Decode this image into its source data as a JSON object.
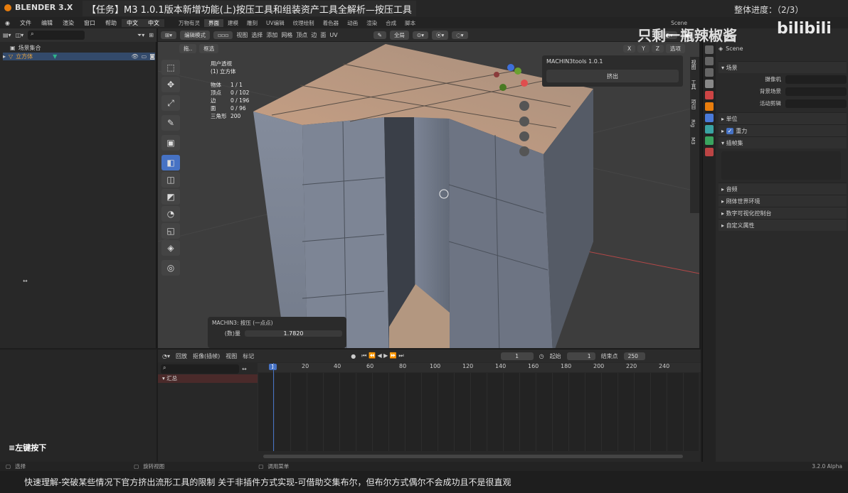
{
  "app": {
    "name": "BLENDER 3.X",
    "task_title": "【任务】M3 1.0.1版本新增功能(上)按压工具和组装资产工具全解析—按压工具",
    "progress": "整体进度：（2/3）"
  },
  "menu": {
    "items": [
      "文件",
      "编辑",
      "渲染",
      "窗口",
      "帮助",
      "中文",
      "中文"
    ],
    "workspaces": [
      "万物有灵",
      "界面",
      "建模",
      "雕刻",
      "UV编辑",
      "纹理绘制",
      "着色器",
      "动画",
      "渲染",
      "合成",
      "脚本"
    ],
    "active_workspace": "界面",
    "scene": "Scene"
  },
  "outliner": {
    "collection": "场景集合",
    "object": "立方体"
  },
  "viewport": {
    "mode": "编辑模式",
    "menus": [
      "视图",
      "选择",
      "添加",
      "网格",
      "顶点",
      "边",
      "面",
      "UV"
    ],
    "global": "全局",
    "select_dd": "拖..",
    "select_box": "框选",
    "axes": [
      "X",
      "Y",
      "Z"
    ],
    "options": "选项",
    "info": {
      "view": "用户透视",
      "object": "(1) 立方体",
      "rows": [
        [
          "物体",
          "1 / 1"
        ],
        [
          "顶点",
          "0 / 102"
        ],
        [
          "边",
          "0 / 196"
        ],
        [
          "面",
          "0 / 96"
        ],
        [
          "三角形",
          "200"
        ]
      ]
    }
  },
  "npanel": {
    "title": "MACHIN3tools 1.0.1",
    "button": "挤出",
    "tabs": [
      "视图",
      "工具",
      "项目",
      "Rig",
      "M3"
    ]
  },
  "redo_panel": {
    "title": "MACHIN3: 按压 (一点点)",
    "field_label": "(数)量",
    "field_value": "1.7820"
  },
  "properties": {
    "scene_title": "Scene",
    "section_scene": "场景",
    "camera_label": "摄像机",
    "bg_label": "背景场景",
    "clip_label": "活动剪辑",
    "sections": [
      "单位",
      "重力",
      "插帧集",
      "音频",
      "刚体世界环境",
      "数字可视化控制台",
      "自定义属性"
    ]
  },
  "timeline": {
    "menus": [
      "回放",
      "抠像(插帧)",
      "视图",
      "标记"
    ],
    "current_frame": "1",
    "start_label": "起始",
    "start": "1",
    "end_label": "结束点",
    "end": "250",
    "ticks": [
      "1",
      "20",
      "40",
      "60",
      "80",
      "100",
      "120",
      "140",
      "160",
      "180",
      "200",
      "220",
      "240"
    ],
    "summary": "汇总"
  },
  "statusbar": {
    "left": "选择",
    "mid": "旋转视图",
    "right": "调用菜单",
    "version": "3.2.0 Alpha"
  },
  "overlay": {
    "key_hint": "≡左键按下",
    "watermark": "只剩一瓶辣椒酱",
    "site": "bilibili"
  },
  "subtitle": "快速理解-突破某些情况下官方挤出流形工具的限制 关于非插件方式实现-可借助交集布尔，但布尔方式偶尔不会成功且不是很直观"
}
